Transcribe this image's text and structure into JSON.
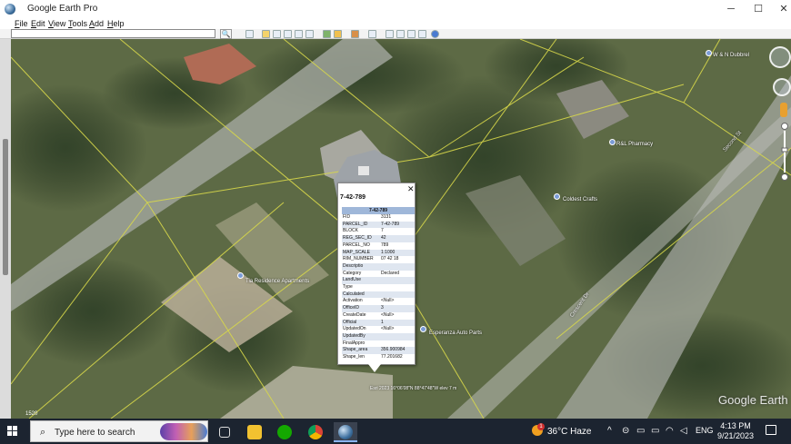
{
  "window": {
    "title": "Google Earth Pro",
    "minimize": "─",
    "maximize": "☐",
    "close": "✕"
  },
  "menu": [
    "File",
    "Edit",
    "View",
    "Tools",
    "Add",
    "Help"
  ],
  "search": {
    "value": "",
    "button": "🔍"
  },
  "map": {
    "places": [
      {
        "label": "W & N Dubbrel",
        "kind": "business"
      },
      {
        "label": "R&L Pharmacy",
        "kind": "business"
      },
      {
        "label": "Coldest Crafts",
        "kind": "business"
      },
      {
        "label": "Tia Residence Apartments",
        "kind": "business"
      },
      {
        "label": "Esperanza Auto Parts",
        "kind": "business"
      }
    ],
    "roads": [
      "Second St",
      "Crescent Dr"
    ],
    "watermark": "Google Earth",
    "scale_label": "1520",
    "status_text": "Esri 2023  16°06'08\"N 88°47'48\"W  elev 7 m"
  },
  "popup": {
    "title": "7-42-789",
    "close": "✕",
    "table_header": "7-42-789",
    "rows": [
      [
        "FID",
        "3131"
      ],
      [
        "PARCEL_ID",
        "7-42-789"
      ],
      [
        "BLOCK",
        "7"
      ],
      [
        "REG_SEC_ID",
        "42"
      ],
      [
        "PARCEL_NO",
        "789"
      ],
      [
        "MAP_SCALE",
        "1:1000"
      ],
      [
        "RIM_NUMBER",
        "07 42 18"
      ],
      [
        "Descriptio",
        ""
      ],
      [
        "Category",
        "Declared"
      ],
      [
        "LandUse",
        ""
      ],
      [
        "Type",
        ""
      ],
      [
        "Calculated",
        ""
      ],
      [
        "Activation",
        "<Null>"
      ],
      [
        "OfficeID",
        "3"
      ],
      [
        "CreateDate",
        "<Null>"
      ],
      [
        "Official",
        "1"
      ],
      [
        "UpdatedOn",
        "<Null>"
      ],
      [
        "UpdatedBy",
        ""
      ],
      [
        "FinalAppro",
        ""
      ],
      [
        "Shape_area",
        "356.900984"
      ],
      [
        "Shape_len",
        "77.201682"
      ]
    ]
  },
  "taskbar": {
    "search_placeholder": "Type here to search",
    "apps": [
      "task-view",
      "file-explorer",
      "upwork",
      "chrome",
      "google-earth"
    ],
    "weather": "36°C  Haze",
    "weather_badge": "1",
    "language": "ENG",
    "time": "4:13 PM",
    "date": "9/21/2023"
  },
  "colors": {
    "taskbar": "#1c2430",
    "popup_header": "#9fb7d9",
    "parcel_lines": "#d8d84a"
  }
}
